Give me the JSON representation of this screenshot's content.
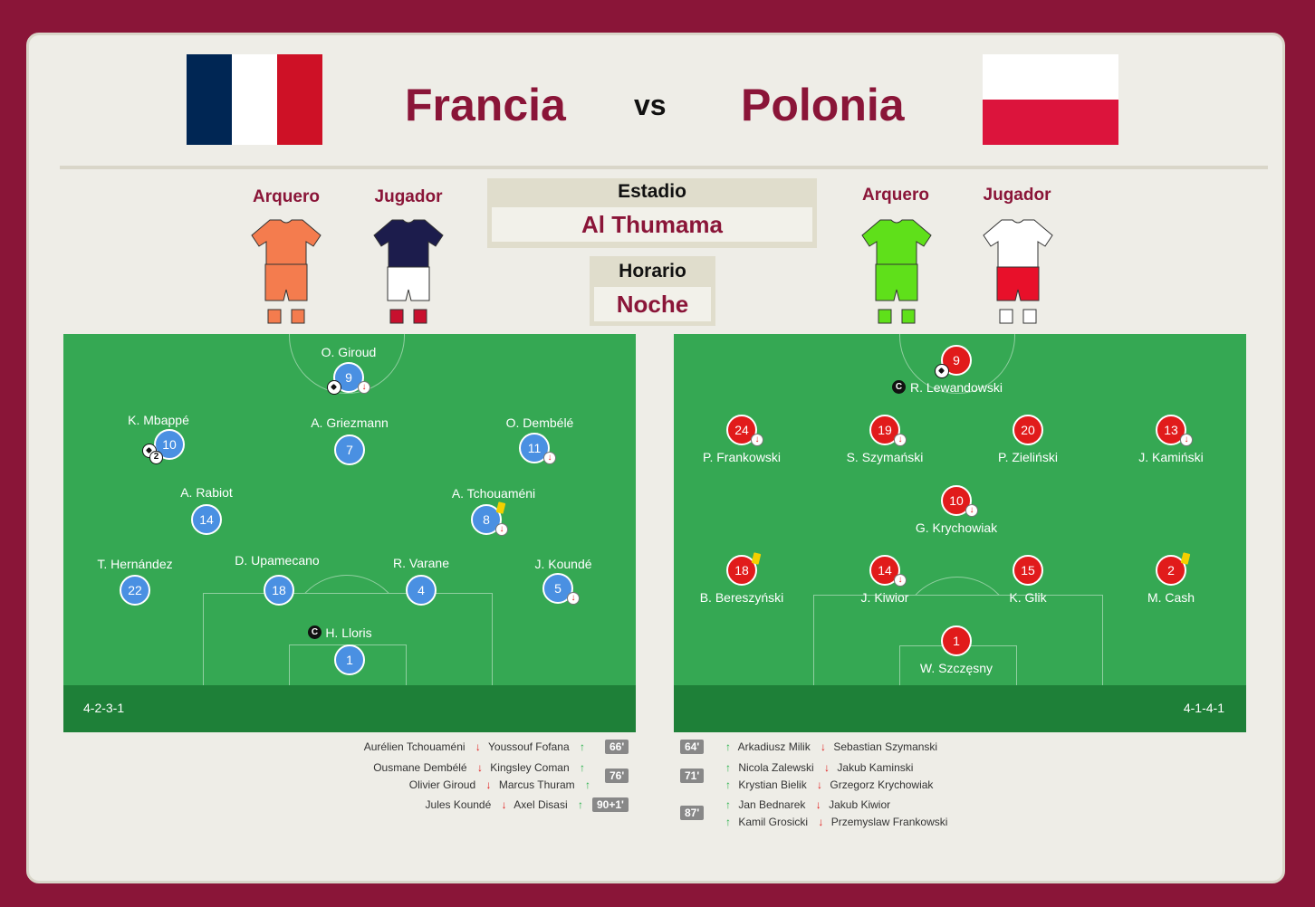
{
  "match": {
    "home": "Francia",
    "away": "Polonia",
    "vs": "vs"
  },
  "kits": {
    "home_gk_label": "Arquero",
    "home_pl_label": "Jugador",
    "away_gk_label": "Arquero",
    "away_pl_label": "Jugador"
  },
  "venue": {
    "stadium_label": "Estadio",
    "stadium": "Al Thumama",
    "time_label": "Horario",
    "time": "Noche"
  },
  "home_lineup": {
    "formation": "4-2-3-1",
    "players": [
      {
        "number": "9",
        "name": "O. Giroud"
      },
      {
        "number": "10",
        "name": "K. Mbappé",
        "goals": "2"
      },
      {
        "number": "7",
        "name": "A. Griezmann"
      },
      {
        "number": "11",
        "name": "O. Dembélé"
      },
      {
        "number": "14",
        "name": "A. Rabiot"
      },
      {
        "number": "8",
        "name": "A. Tchouaméni"
      },
      {
        "number": "22",
        "name": "T. Hernández"
      },
      {
        "number": "18",
        "name": "D. Upamecano"
      },
      {
        "number": "4",
        "name": "R. Varane"
      },
      {
        "number": "5",
        "name": "J. Koundé"
      },
      {
        "number": "1",
        "name": "H. Lloris"
      }
    ]
  },
  "away_lineup": {
    "formation": "4-1-4-1",
    "players": [
      {
        "number": "9",
        "name": "R. Lewandowski"
      },
      {
        "number": "24",
        "name": "P. Frankowski"
      },
      {
        "number": "19",
        "name": "S. Szymański"
      },
      {
        "number": "20",
        "name": "P. Zieliński"
      },
      {
        "number": "13",
        "name": "J. Kamiński"
      },
      {
        "number": "10",
        "name": "G. Krychowiak"
      },
      {
        "number": "18",
        "name": "B. Bereszyński"
      },
      {
        "number": "14",
        "name": "J. Kiwior"
      },
      {
        "number": "15",
        "name": "K. Glik"
      },
      {
        "number": "2",
        "name": "M. Cash"
      },
      {
        "number": "1",
        "name": "W. Szczęsny"
      }
    ]
  },
  "captain_mark": "C",
  "arrows": {
    "down": "↓",
    "up": "↑"
  },
  "home_subs": [
    {
      "minute": "66'",
      "rows": [
        {
          "out": "Aurélien Tchouaméni",
          "in": "Youssouf Fofana"
        }
      ]
    },
    {
      "minute": "76'",
      "rows": [
        {
          "out": "Ousmane Dembélé",
          "in": "Kingsley Coman"
        },
        {
          "out": "Olivier Giroud",
          "in": "Marcus Thuram"
        }
      ]
    },
    {
      "minute": "90+1'",
      "rows": [
        {
          "out": "Jules Koundé",
          "in": "Axel Disasi"
        }
      ]
    }
  ],
  "away_subs": [
    {
      "minute": "64'",
      "rows": [
        {
          "in": "Arkadiusz Milik",
          "out": "Sebastian Szymanski"
        }
      ]
    },
    {
      "minute": "71'",
      "rows": [
        {
          "in": "Nicola Zalewski",
          "out": "Jakub Kaminski"
        },
        {
          "in": "Krystian Bielik",
          "out": "Grzegorz Krychowiak"
        }
      ]
    },
    {
      "minute": "87'",
      "rows": [
        {
          "in": "Jan Bednarek",
          "out": "Jakub Kiwior"
        },
        {
          "in": "Kamil Grosicki",
          "out": "Przemyslaw Frankowski"
        }
      ]
    }
  ],
  "colors": {
    "brand": "#8a1538",
    "home_disc": "#4a90e2",
    "away_disc": "#e11b1b",
    "pitch": "#35a853",
    "pitch_band": "#1e8038"
  }
}
